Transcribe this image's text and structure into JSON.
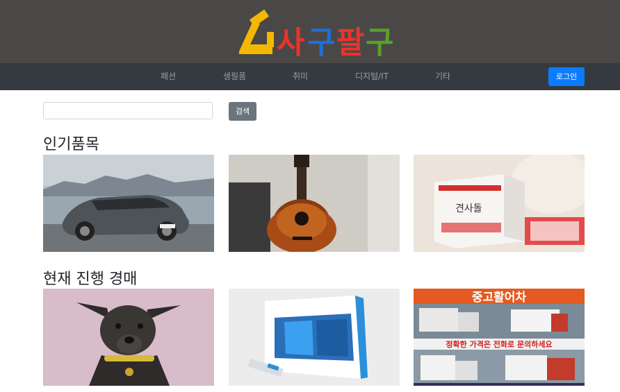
{
  "brand": {
    "logo_text": "사구팔구",
    "colors": [
      "#f5b800",
      "#e8342a",
      "#1e6fd9",
      "#e8342a",
      "#5aa02c"
    ]
  },
  "nav": {
    "items": [
      {
        "label": "패션"
      },
      {
        "label": "생필품"
      },
      {
        "label": "취미"
      },
      {
        "label": "디지털/IT"
      },
      {
        "label": "기타"
      }
    ],
    "login_label": "로그인"
  },
  "search": {
    "value": "",
    "button_label": "검색"
  },
  "sections": {
    "popular_title": "인기품목",
    "auction_title": "현재 진행 경매"
  },
  "popular_items": [
    {
      "image": "sedan-car-photo"
    },
    {
      "image": "acoustic-guitar-photo"
    },
    {
      "image": "pet-product-box-photo",
      "box_text": "견사돌"
    }
  ],
  "auction_items": [
    {
      "image": "dog-photo"
    },
    {
      "image": "windows10-box-photo"
    },
    {
      "image": "used-truck-ad-photo",
      "headline": "중고활어차",
      "subtext": "정확한 가격은 전화로 문의하세요"
    }
  ]
}
